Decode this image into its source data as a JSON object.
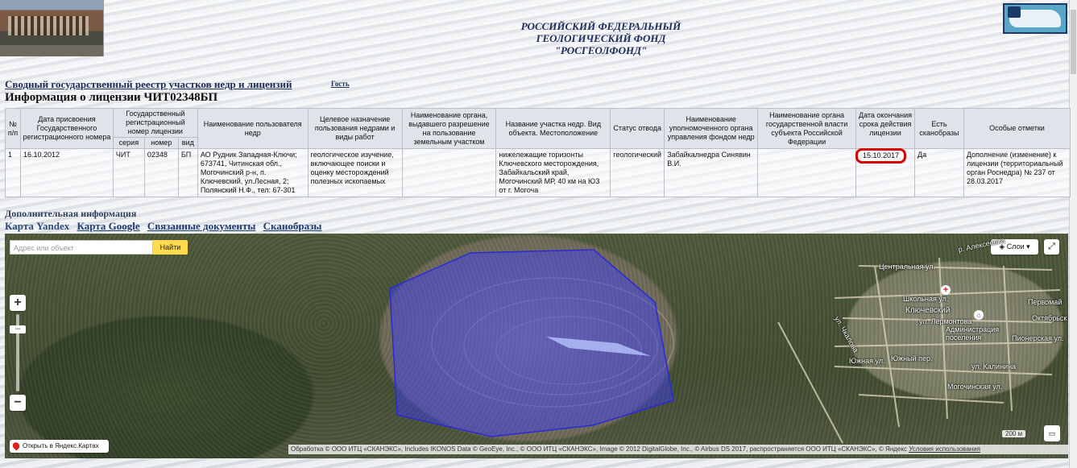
{
  "header": {
    "title_lines": [
      "РОССИЙСКИЙ ФЕДЕРАЛЬНЫЙ",
      "ГЕОЛОГИЧЕСКИЙ ФОНД",
      "\"РОСГЕОЛФОНД\""
    ]
  },
  "nav": {
    "registry_link": "Сводный государственный реестр участков недр и лицензий",
    "guest_link": "Гость",
    "license_title": "Информация о лицензии ЧИТ02348БП"
  },
  "table": {
    "headers": {
      "num": "№ п/п",
      "date_assigned": "Дата присвоения Государственного регистрационного номера",
      "reg_number": "Государственный регистрационный номер лицензии",
      "series": "серия",
      "number": "номер",
      "type": "вид",
      "owner": "Наименование пользователя недр",
      "purpose": "Целевое назначение пользования недрами и виды работ",
      "permit_org": "Наименование органа, выдавшего разрешение на пользование земельным участком",
      "site_name": "Название участка недр. Вид объекта. Местоположение",
      "allotment_status": "Статус отвода",
      "authority": "Наименование уполномоченного органа управления фондом недр",
      "regional_authority": "Наименование органа государственной власти субъекта Российской Федерации",
      "expiry_date": "Дата окончания срока действия лицензии",
      "has_scans": "Есть сканобразы",
      "notes": "Особые отметки"
    },
    "row": {
      "num": "1",
      "date_assigned": "16.10.2012",
      "series": "ЧИТ",
      "number": "02348",
      "type": "БП",
      "owner": "АО Рудник Западная-Ключи; 673741, Читинская обл., Могочинский р-н, п. Ключевский, ул.Лесная, 2; Полянский Н.Ф., тел: 67-301",
      "purpose": "геологическое изучение, включающее поиски и оценку месторождений полезных ископаемых",
      "permit_org": "",
      "site_name": "нижележащие горизонты Ключевского месторождения, Забайкальский край, Могочинский МР, 40 км на ЮЗ от г. Могоча",
      "allotment_status": "геологический",
      "authority": "Забайкалнедра Синявин В.И.",
      "regional_authority": "",
      "expiry_date": "15.10.2017",
      "has_scans": "Да",
      "notes": "Дополнение (изменение) к лицензии (территориальный орган Роснедра) № 237 от 28.03.2017"
    }
  },
  "additional": {
    "heading": "Дополнительная информация",
    "tabs": [
      "Карта Yandex",
      "Карта Google",
      "Связанные документы",
      "Сканобразы"
    ]
  },
  "map": {
    "search_placeholder": "Адрес или объект",
    "find_label": "Найти",
    "layers_label": "Слои",
    "zoom_in": "+",
    "zoom_out": "−",
    "open_in_yandex": "Открыть в Яндекс.Картах",
    "scale": "200 м",
    "copyright": "Обработка © ООО ИТЦ «СКАНЭКС», Includes IKONOS Data © GeoEye, Inc., © ООО ИТЦ «СКАНЭКС», Image © 2012 DigitalGlobe, Inc., © Airbus DS 2017, распространяется ООО ИТЦ «СКАНЭКС», © Яндекс",
    "terms": "Условия использования",
    "labels": {
      "village": "Ключевский",
      "admin": "Администрация поселения",
      "street_central": "Центральная ул.",
      "street_school": "Школьная ул.",
      "street_lermontov": "ул. Лермонтова",
      "street_pervomay": "Первомай",
      "street_oktyabr": "Октябрьск",
      "street_pioneer": "Пионерская ул.",
      "street_kalinin": "ул. Калинина",
      "street_mogocha": "Могочинская ул.",
      "street_southern": "Южная ул.",
      "street_yuzhny": "Южный пер.",
      "street_ul": "ул. Чкалова",
      "river": "р. Алексеевка"
    },
    "colors": {
      "polygon_fill": "#3a3aff",
      "polygon_stroke": "#2a2ad8"
    }
  }
}
